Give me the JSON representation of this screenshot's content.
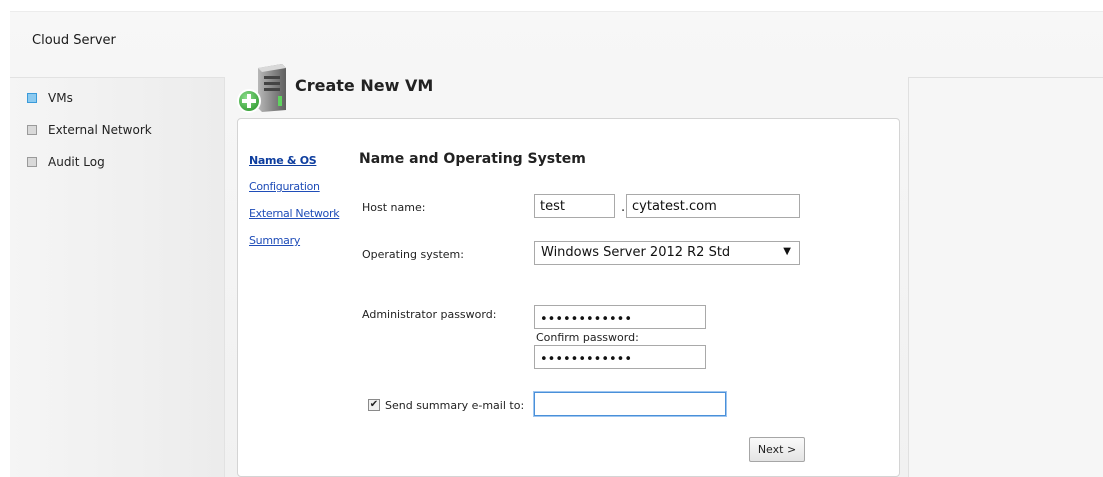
{
  "app": {
    "title": "Cloud Server"
  },
  "sidebar": {
    "items": [
      {
        "label": "VMs",
        "active": true
      },
      {
        "label": "External Network",
        "active": false
      },
      {
        "label": "Audit Log",
        "active": false
      }
    ]
  },
  "header": {
    "title": "Create New VM",
    "icon": "server-add-icon"
  },
  "wizard": {
    "steps": [
      {
        "label": "Name & OS",
        "current": true
      },
      {
        "label": "Configuration",
        "current": false
      },
      {
        "label": "External Network",
        "current": false
      },
      {
        "label": "Summary",
        "current": false
      }
    ],
    "section_title": "Name and Operating System"
  },
  "form": {
    "host_name_label": "Host name:",
    "host_name_value": "test",
    "domain_separator": ".",
    "domain_value": "cytatest.com",
    "os_label": "Operating system:",
    "os_value": "Windows Server 2012 R2 Std",
    "admin_password_label": "Administrator password:",
    "admin_password_value": "••••••••••••",
    "confirm_password_label": "Confirm password:",
    "confirm_password_value": "••••••••••••",
    "send_summary_label": "Send summary e-mail to:",
    "send_summary_checked": true,
    "email_value": "",
    "next_label": "Next >"
  },
  "colors": {
    "active_nav": "#8ccaf0",
    "link": "#1f4db8",
    "accent_green": "#3aa53a"
  }
}
